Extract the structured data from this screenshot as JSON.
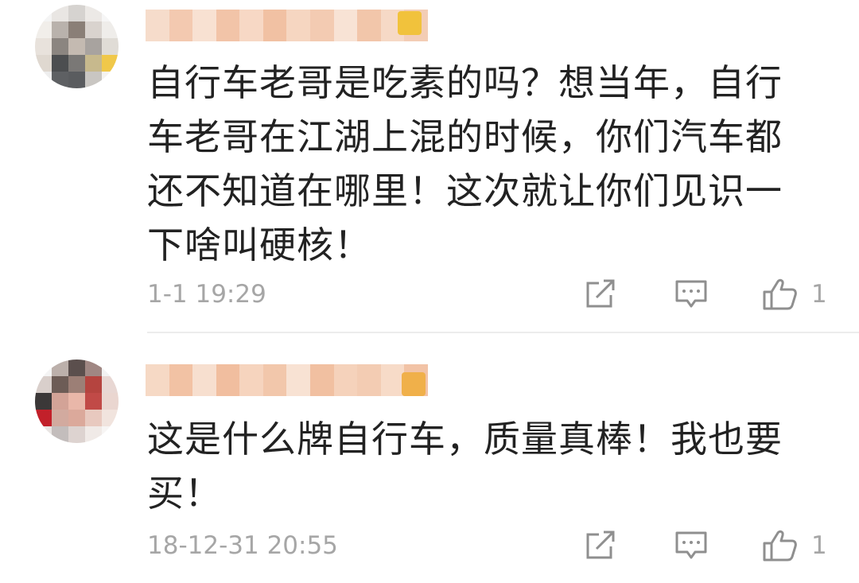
{
  "comments": [
    {
      "text": "自行车老哥是吃素的吗？想当年，自行车老哥在江湖上混的时候，你们汽车都还不知道在哪里！这次就让你们见识一下啥叫硬核！",
      "timestamp": "1-1 19:29",
      "like_count": "1",
      "icons": [
        "share-icon",
        "reply-icon",
        "like-icon"
      ]
    },
    {
      "text": "这是什么牌自行车，质量真棒！我也要买！",
      "timestamp": "18-12-31 20:55",
      "like_count": "1",
      "icons": [
        "share-icon",
        "reply-icon",
        "like-icon"
      ]
    }
  ],
  "colors": {
    "text": "#222222",
    "meta": "#a6a6a6",
    "icon": "#8f8f8f",
    "divider": "#ececec",
    "background": "#ffffff"
  }
}
